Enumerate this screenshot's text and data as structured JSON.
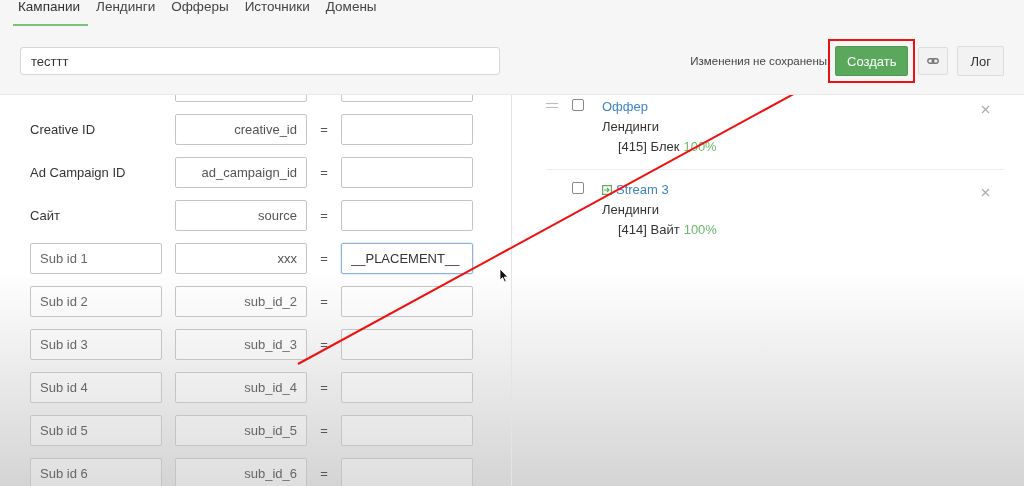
{
  "tabs": [
    {
      "label": "Кампании",
      "selected": true
    },
    {
      "label": "Лендинги",
      "selected": false
    },
    {
      "label": "Офферы",
      "selected": false
    },
    {
      "label": "Источники",
      "selected": false
    },
    {
      "label": "Домены",
      "selected": false
    }
  ],
  "campaign_name": {
    "value": "тесттт"
  },
  "toolbar": {
    "status": "Изменения не сохранены",
    "create_button": {
      "label": "Создать",
      "highlighted": true
    },
    "log_button": "Лог"
  },
  "parameters": [
    {
      "kind": "cut"
    },
    {
      "kind": "fixed",
      "label": "Creative ID",
      "param": {
        "value": "creative_id"
      },
      "equals": "="
    },
    {
      "kind": "fixed",
      "label": "Ad Campaign ID",
      "param": {
        "value": "ad_campaign_id"
      },
      "equals": "="
    },
    {
      "kind": "fixed",
      "label": "Сайт",
      "param": {
        "value": "source"
      },
      "equals": "="
    },
    {
      "kind": "custom",
      "name": {
        "placeholder": "Sub id 1"
      },
      "param": {
        "value": "xxx"
      },
      "equals": "=",
      "target": {
        "value": "__PLACEMENT__",
        "focused": true
      }
    },
    {
      "kind": "custom",
      "name": {
        "placeholder": "Sub id 2"
      },
      "param": {
        "placeholder": "sub_id_2"
      },
      "equals": "="
    },
    {
      "kind": "custom",
      "name": {
        "placeholder": "Sub id 3"
      },
      "param": {
        "placeholder": "sub_id_3"
      },
      "equals": "="
    },
    {
      "kind": "custom",
      "name": {
        "placeholder": "Sub id 4"
      },
      "param": {
        "placeholder": "sub_id_4"
      },
      "equals": "="
    },
    {
      "kind": "custom",
      "name": {
        "placeholder": "Sub id 5"
      },
      "param": {
        "placeholder": "sub_id_5"
      },
      "equals": "="
    },
    {
      "kind": "custom",
      "name": {
        "placeholder": "Sub id 6"
      },
      "param": {
        "placeholder": "sub_id_6"
      },
      "equals": "="
    }
  ],
  "streams": [
    {
      "title": "Оффер",
      "kind": "offer",
      "checked": false,
      "section": "Лендинги",
      "landings": [
        {
          "name": "[415] Блек",
          "share": "100%"
        }
      ]
    },
    {
      "title": "Stream 3",
      "kind": "forward",
      "checked": false,
      "section": "Лендинги",
      "landings": [
        {
          "name": "[414] Вайт",
          "share": "100%"
        }
      ]
    }
  ]
}
